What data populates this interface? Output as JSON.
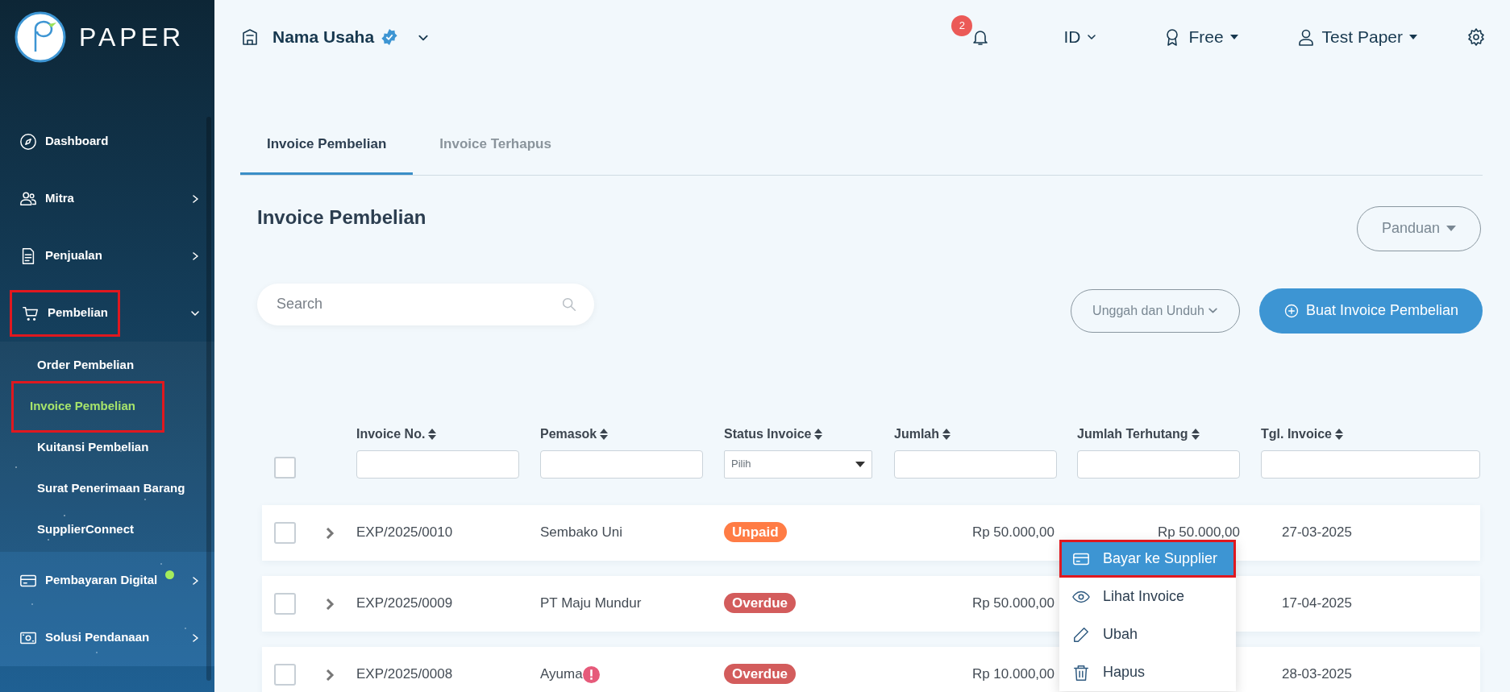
{
  "sidebar": {
    "brand": "PAPER",
    "items": [
      {
        "label": "Dashboard",
        "kind": "link"
      },
      {
        "label": "Mitra",
        "kind": "group",
        "expanded": false
      },
      {
        "label": "Penjualan",
        "kind": "group",
        "expanded": false
      },
      {
        "label": "Pembelian",
        "kind": "group",
        "expanded": true,
        "highlighted": true,
        "children": [
          {
            "label": "Order Pembelian",
            "selected": false,
            "highlighted": false
          },
          {
            "label": "Invoice Pembelian",
            "selected": true,
            "highlighted": true
          },
          {
            "label": "Kuitansi Pembelian",
            "selected": false,
            "highlighted": false
          },
          {
            "label": "Surat Penerimaan Barang",
            "selected": false,
            "highlighted": false
          },
          {
            "label": "SupplierConnect",
            "selected": false,
            "highlighted": false
          }
        ]
      },
      {
        "label": "Pembayaran Digital",
        "kind": "group",
        "expanded": false,
        "new_dot": true
      },
      {
        "label": "Solusi Pendanaan",
        "kind": "group",
        "expanded": false
      }
    ]
  },
  "header": {
    "business": "Nama Usaha",
    "verified": true,
    "notifications": "2",
    "language": "ID",
    "plan": "Free",
    "user": "Test Paper"
  },
  "tabs": [
    {
      "label": "Invoice Pembelian",
      "selected": true
    },
    {
      "label": "Invoice Terhapus",
      "selected": false
    }
  ],
  "page_title": "Invoice Pembelian",
  "guide_button": "Panduan",
  "search": {
    "placeholder": "Search"
  },
  "upload_button": "Unggah dan Unduh",
  "create_button": "Buat Invoice Pembelian",
  "table": {
    "select_all": false,
    "columns": [
      {
        "label": "Invoice No.",
        "kind": "text"
      },
      {
        "label": "Pemasok",
        "kind": "text"
      },
      {
        "label": "Status Invoice",
        "kind": "select",
        "placeholder": "Pilih"
      },
      {
        "label": "Jumlah",
        "kind": "text"
      },
      {
        "label": "Jumlah Terhutang",
        "kind": "text"
      },
      {
        "label": "Tgl. Invoice",
        "kind": "text"
      }
    ],
    "rows": [
      {
        "checked": false,
        "expanded": false,
        "invoice_no": "EXP/2025/0010",
        "supplier": "Sembako Uni",
        "warning": false,
        "status": {
          "label": "Unpaid",
          "color": "#ff7c45"
        },
        "amount": "Rp 50.000,00",
        "outstanding": "Rp 50.000,00",
        "date": "27-03-2025"
      },
      {
        "checked": false,
        "expanded": false,
        "invoice_no": "EXP/2025/0009",
        "supplier": "PT Maju Mundur",
        "warning": false,
        "status": {
          "label": "Overdue",
          "color": "#d35c5c"
        },
        "amount": "Rp 50.000,00",
        "date": "17-04-2025"
      },
      {
        "checked": false,
        "expanded": false,
        "invoice_no": "EXP/2025/0008",
        "supplier": "Ayuma",
        "warning": true,
        "status": {
          "label": "Overdue",
          "color": "#d35c5c"
        },
        "amount": "Rp 10.000,00",
        "date": "28-03-2025"
      }
    ]
  },
  "row_menu": [
    {
      "label": "Bayar ke Supplier",
      "selected": true,
      "highlighted": true
    },
    {
      "label": "Lihat Invoice",
      "selected": false,
      "highlighted": false
    },
    {
      "label": "Ubah",
      "selected": false,
      "highlighted": false
    },
    {
      "label": "Hapus",
      "selected": false,
      "highlighted": false
    }
  ]
}
